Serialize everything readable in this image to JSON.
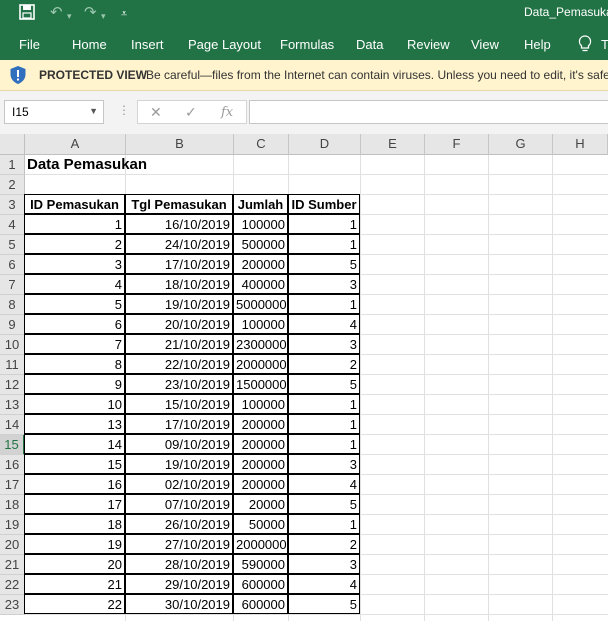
{
  "window": {
    "document_title": "Data_Pemasuka"
  },
  "ribbon": {
    "tabs": [
      "File",
      "Home",
      "Insert",
      "Page Layout",
      "Formulas",
      "Data",
      "Review",
      "View",
      "Help"
    ],
    "tell_me_partial": "T"
  },
  "protected_view": {
    "label": "PROTECTED VIEW",
    "message": "Be careful—files from the Internet can contain viruses. Unless you need to edit, it's safer"
  },
  "formula_bar": {
    "name_box": "I15",
    "formula": ""
  },
  "grid": {
    "columns": [
      "A",
      "B",
      "C",
      "D",
      "E",
      "F",
      "G",
      "H"
    ],
    "selected_row": 15,
    "rows": [
      "1",
      "2",
      "3",
      "4",
      "5",
      "6",
      "7",
      "8",
      "9",
      "10",
      "11",
      "12",
      "13",
      "14",
      "15",
      "16",
      "17",
      "18",
      "19",
      "20",
      "21",
      "22",
      "23"
    ]
  },
  "sheet": {
    "title": "Data Pemasukan",
    "headers": [
      "ID Pemasukan",
      "Tgl Pemasukan",
      "Jumlah",
      "ID Sumber"
    ],
    "records": [
      [
        "1",
        "16/10/2019",
        "100000",
        "1"
      ],
      [
        "2",
        "24/10/2019",
        "500000",
        "1"
      ],
      [
        "3",
        "17/10/2019",
        "200000",
        "5"
      ],
      [
        "4",
        "18/10/2019",
        "400000",
        "3"
      ],
      [
        "5",
        "19/10/2019",
        "5000000",
        "1"
      ],
      [
        "6",
        "20/10/2019",
        "100000",
        "4"
      ],
      [
        "7",
        "21/10/2019",
        "2300000",
        "3"
      ],
      [
        "8",
        "22/10/2019",
        "2000000",
        "2"
      ],
      [
        "9",
        "23/10/2019",
        "1500000",
        "5"
      ],
      [
        "10",
        "15/10/2019",
        "100000",
        "1"
      ],
      [
        "13",
        "17/10/2019",
        "200000",
        "1"
      ],
      [
        "14",
        "09/10/2019",
        "200000",
        "1"
      ],
      [
        "15",
        "19/10/2019",
        "200000",
        "3"
      ],
      [
        "16",
        "02/10/2019",
        "200000",
        "4"
      ],
      [
        "17",
        "07/10/2019",
        "20000",
        "5"
      ],
      [
        "18",
        "26/10/2019",
        "50000",
        "1"
      ],
      [
        "19",
        "27/10/2019",
        "2000000",
        "2"
      ],
      [
        "20",
        "28/10/2019",
        "590000",
        "3"
      ],
      [
        "21",
        "29/10/2019",
        "600000",
        "4"
      ],
      [
        "22",
        "30/10/2019",
        "600000",
        "5"
      ]
    ]
  },
  "colors": {
    "brand_green": "#217346",
    "warning_bar": "#fff4ce"
  }
}
